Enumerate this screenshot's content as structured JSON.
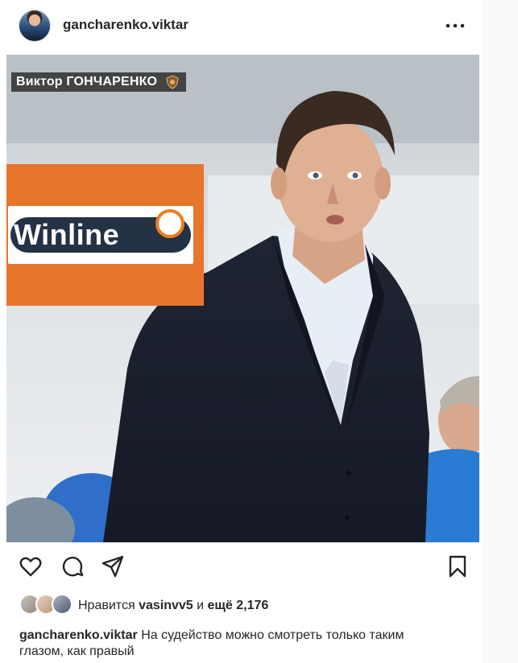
{
  "post": {
    "username": "gancharenko.viktar",
    "more_label": "More options"
  },
  "photo": {
    "caption_title": "Виктор ГОНЧАРЕНКО",
    "banner_text": "Winline"
  },
  "actions": {
    "like_icon": "heart-icon",
    "comment_icon": "comment-icon",
    "share_icon": "send-icon",
    "save_icon": "bookmark-icon"
  },
  "likes": {
    "prefix": "Нравится",
    "user": "vasinvv5",
    "and": "и",
    "others": "ещё 2,176"
  },
  "caption": {
    "username": "gancharenko.viktar",
    "text": "На судейство можно смотреть только таким глазом, как правый"
  },
  "colors": {
    "text": "#262626",
    "border": "#dbdbdb",
    "banner_orange": "#e8752c",
    "banner_navy": "#233245"
  }
}
